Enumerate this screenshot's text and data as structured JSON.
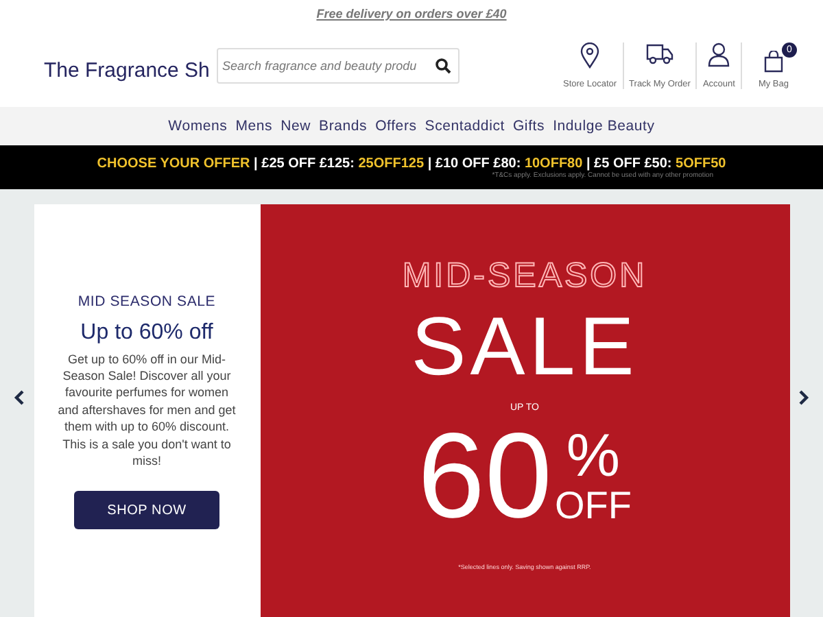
{
  "promo_link": "Free delivery on orders over £40",
  "logo": "The Fragrance Sh",
  "search": {
    "placeholder": "Search fragrance and beauty produ"
  },
  "header_links": [
    {
      "kind": "pin",
      "label": "Store Locator"
    },
    {
      "kind": "truck",
      "label": "Track My Order"
    },
    {
      "kind": "person",
      "label": "Account"
    },
    {
      "kind": "bag",
      "label": "My Bag",
      "badge": "0"
    }
  ],
  "nav": [
    "Womens",
    "Mens",
    "New",
    "Brands",
    "Offers",
    "Scentaddict",
    "Gifts",
    "Indulge Beauty"
  ],
  "offer_bar": {
    "parts": [
      {
        "text": "CHOOSE YOUR OFFER",
        "highlight": true
      },
      {
        "text": " | £25 OFF £125: ",
        "highlight": false
      },
      {
        "text": "25OFF125",
        "highlight": true
      },
      {
        "text": " | £10 OFF £80: ",
        "highlight": false
      },
      {
        "text": "10OFF80",
        "highlight": true
      },
      {
        "text": " | £5 OFF £50: ",
        "highlight": false
      },
      {
        "text": "5OFF50",
        "highlight": true
      }
    ],
    "note": "*T&Cs apply. Exclusions apply. Cannot be used with any other promotion"
  },
  "hero": {
    "eyebrow": "MID SEASON SALE",
    "heading": "Up to 60% off",
    "body": "Get up to 60% off in our Mid-Season Sale! Discover all your favourite perfumes for women and aftershaves for men and get them with up to 60% discount. This is a sale you don't want to miss!",
    "button": "SHOP NOW",
    "banner": {
      "outline": "MID-SEASON",
      "big": "SALE",
      "up_to": "UP TO",
      "number": "60",
      "percent": "%",
      "off": "OFF",
      "small_print": "*Selected lines only. Saving shown against RRP."
    }
  }
}
